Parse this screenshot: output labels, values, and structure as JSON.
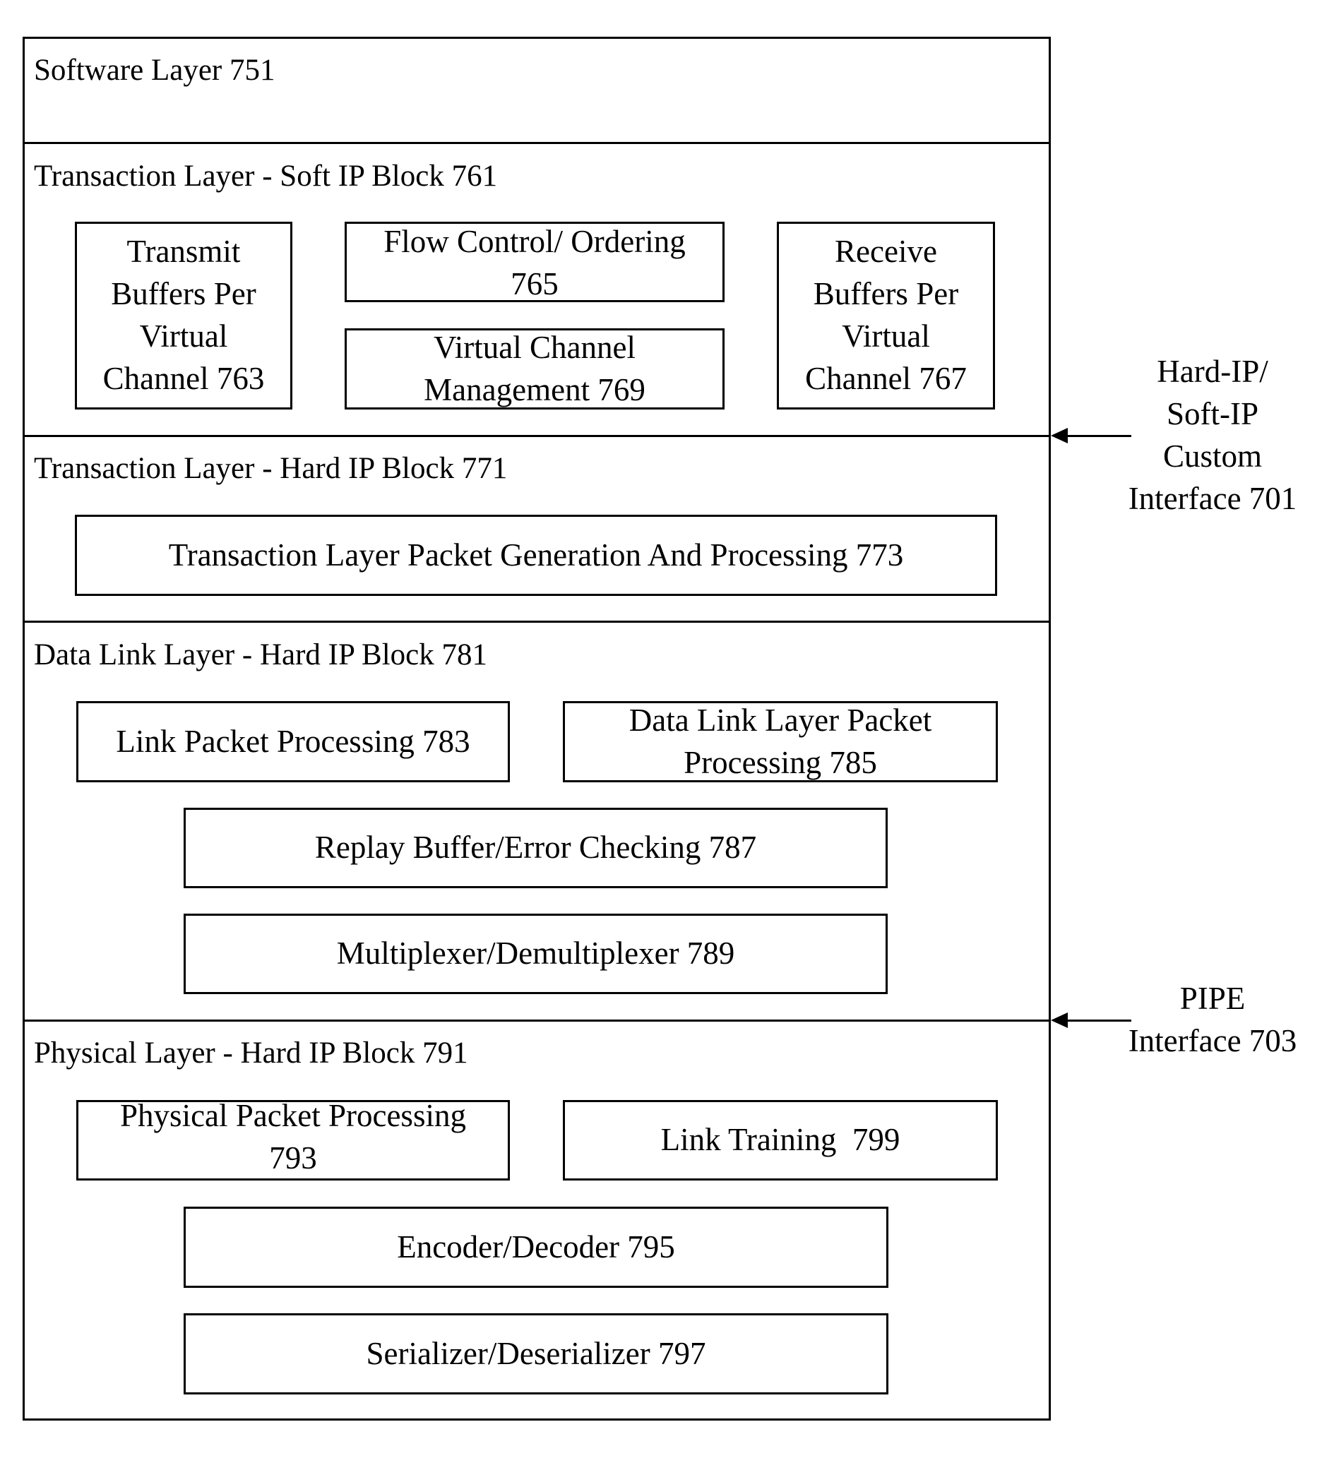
{
  "diagram": {
    "layers": [
      {
        "id": "software",
        "title": "Software Layer 751"
      },
      {
        "id": "transaction-soft",
        "title": "Transaction Layer - Soft IP Block 761",
        "blocks": [
          {
            "lines": [
              "Transmit",
              "Buffers Per",
              "Virtual",
              "Channel 763"
            ]
          },
          {
            "lines": [
              "Flow Control/ Ordering",
              "765"
            ]
          },
          {
            "lines": [
              "Virtual Channel",
              "Management 769"
            ]
          },
          {
            "lines": [
              "Receive",
              "Buffers Per",
              "Virtual",
              "Channel 767"
            ]
          }
        ]
      },
      {
        "id": "transaction-hard",
        "title": "Transaction Layer - Hard IP Block 771",
        "blocks": [
          {
            "lines": [
              "Transaction Layer Packet Generation And Processing 773"
            ]
          }
        ]
      },
      {
        "id": "data-link",
        "title": "Data Link Layer - Hard IP Block 781",
        "blocks": [
          {
            "lines": [
              "Link Packet Processing 783"
            ]
          },
          {
            "lines": [
              "Data Link Layer Packet",
              "Processing 785"
            ]
          },
          {
            "lines": [
              "Replay Buffer/Error Checking 787"
            ]
          },
          {
            "lines": [
              "Multiplexer/Demultiplexer 789"
            ]
          }
        ]
      },
      {
        "id": "physical",
        "title": "Physical Layer - Hard IP Block 791",
        "blocks": [
          {
            "lines": [
              "Physical Packet Processing",
              "793"
            ]
          },
          {
            "lines": [
              "Link Training  799"
            ]
          },
          {
            "lines": [
              "Encoder/Decoder 795"
            ]
          },
          {
            "lines": [
              "Serializer/Deserializer 797"
            ]
          }
        ]
      }
    ],
    "interfaces": [
      {
        "lines": [
          "Hard-IP/",
          "Soft-IP",
          "Custom",
          "Interface 701"
        ]
      },
      {
        "lines": [
          "PIPE",
          "Interface 703"
        ]
      }
    ]
  }
}
